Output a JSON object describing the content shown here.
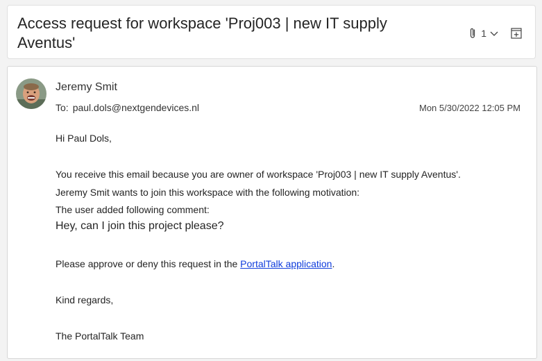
{
  "subject": {
    "title": "Access request for workspace 'Proj003 | new IT supply Aventus'",
    "attachment_count": "1"
  },
  "message": {
    "sender": "Jeremy Smit",
    "to_label": "To:",
    "to_address": "paul.dols@nextgendevices.nl",
    "timestamp": "Mon 5/30/2022 12:05 PM",
    "body": {
      "greeting": "Hi Paul Dols,",
      "line1": "You receive this email because you are owner of workspace 'Proj003 | new IT supply Aventus'.",
      "line2": "Jeremy Smit wants to join this workspace with the following motivation:",
      "line3": "The user added following comment:",
      "comment": "Hey, can I join this project please?",
      "approve_prefix": "Please approve or deny this request in the ",
      "approve_link": "PortalTalk application",
      "approve_suffix": ".",
      "closing": "Kind regards,",
      "signature": "The PortalTalk Team"
    }
  },
  "colors": {
    "link": "#0f3cdc",
    "background": "#f3f3f3"
  },
  "icons": {
    "attachment": "paperclip-icon",
    "dropdown": "chevron-down-icon",
    "expand": "open-in-window-icon"
  }
}
